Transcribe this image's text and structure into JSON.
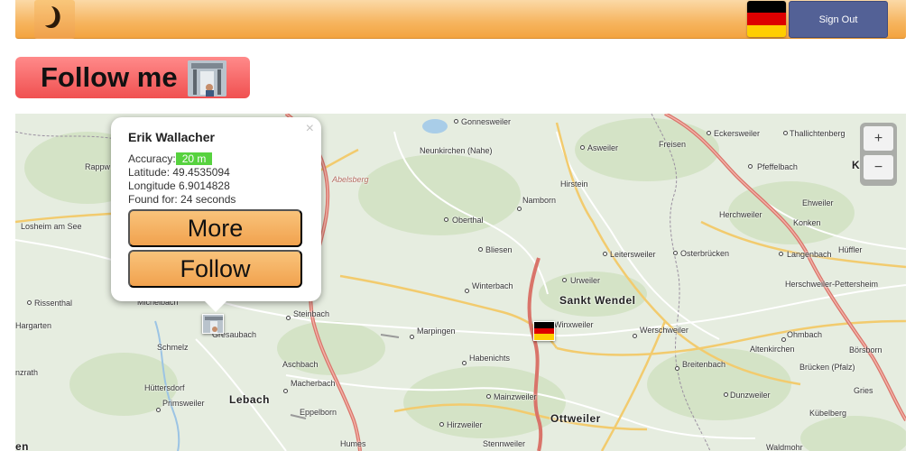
{
  "header": {
    "logo_icon": "crescent-moon-icon",
    "flag_icon": "germany-flag-icon",
    "sign_out_label": "Sign Out",
    "flag_colors": [
      "#000000",
      "#dd0000",
      "#ffce00"
    ]
  },
  "follow_me": {
    "label": "Follow me"
  },
  "map": {
    "zoom_in": "+",
    "zoom_out": "−",
    "places": [
      {
        "name": "Gonnesweiler",
        "big": false
      },
      {
        "name": "Eckersweiler",
        "big": false
      },
      {
        "name": "Thallichtenberg",
        "big": false
      },
      {
        "name": "Neunkirchen (Nahe)",
        "big": false
      },
      {
        "name": "Asweiler",
        "big": false
      },
      {
        "name": "Freisen",
        "big": false
      },
      {
        "name": "Pfeffelbach",
        "big": false
      },
      {
        "name": "Rappw",
        "big": false
      },
      {
        "name": "Abelsberg",
        "big": false
      },
      {
        "name": "Hirstein",
        "big": false
      },
      {
        "name": "Ehweiler",
        "big": false
      },
      {
        "name": "Namborn",
        "big": false
      },
      {
        "name": "Herchweiler",
        "big": false
      },
      {
        "name": "Konken",
        "big": false
      },
      {
        "name": "Losheim am See",
        "big": false
      },
      {
        "name": "Oberthal",
        "big": false
      },
      {
        "name": "Bliesen",
        "big": false
      },
      {
        "name": "Leitersweiler",
        "big": false
      },
      {
        "name": "Osterbrücken",
        "big": false
      },
      {
        "name": "Langenbach",
        "big": false
      },
      {
        "name": "Hüffler",
        "big": false
      },
      {
        "name": "Urweiler",
        "big": false
      },
      {
        "name": "Herschweiler-Pettersheim",
        "big": false
      },
      {
        "name": "Winterbach",
        "big": false
      },
      {
        "name": "Sankt Wendel",
        "big": true
      },
      {
        "name": "Rissenthal",
        "big": false
      },
      {
        "name": "Michelbach",
        "big": false
      },
      {
        "name": "Steinbach",
        "big": false
      },
      {
        "name": "Hargarten",
        "big": false
      },
      {
        "name": "Gresaubach",
        "big": false
      },
      {
        "name": "Marpingen",
        "big": false
      },
      {
        "name": "Winxweiler",
        "big": false
      },
      {
        "name": "Werschweiler",
        "big": false
      },
      {
        "name": "Ohmbach",
        "big": false
      },
      {
        "name": "Schmelz",
        "big": false
      },
      {
        "name": "Altenkirchen",
        "big": false
      },
      {
        "name": "Börsborn",
        "big": false
      },
      {
        "name": "Habenichts",
        "big": false
      },
      {
        "name": "Aschbach",
        "big": false
      },
      {
        "name": "Breitenbach",
        "big": false
      },
      {
        "name": "nzrath",
        "big": false
      },
      {
        "name": "Brücken (Pfalz)",
        "big": false
      },
      {
        "name": "Macherbach",
        "big": false
      },
      {
        "name": "Hüttersdorf",
        "big": false
      },
      {
        "name": "Gries",
        "big": false
      },
      {
        "name": "Mainzweiler",
        "big": false
      },
      {
        "name": "Dunzweiler",
        "big": false
      },
      {
        "name": "Lebach",
        "big": true
      },
      {
        "name": "Primsweiler",
        "big": false
      },
      {
        "name": "Eppelborn",
        "big": false
      },
      {
        "name": "Kübelberg",
        "big": false
      },
      {
        "name": "Ottweiler",
        "big": true
      },
      {
        "name": "Hirzweiler",
        "big": false
      },
      {
        "name": "Humes",
        "big": false
      },
      {
        "name": "Stennweiler",
        "big": false
      },
      {
        "name": "Waldmohr",
        "big": false
      },
      {
        "name": "K",
        "big": true
      },
      {
        "name": "en",
        "big": true
      }
    ]
  },
  "popup": {
    "close_label": "×",
    "name": "Erik Wallacher",
    "accuracy_label": "Accuracy:",
    "accuracy_value": "20 m",
    "latitude": "Latitude: 49.4535094",
    "longitude": "Longitude 6.9014828",
    "found_for": "Found for: 24 seconds",
    "more_label": "More",
    "follow_label": "Follow"
  }
}
